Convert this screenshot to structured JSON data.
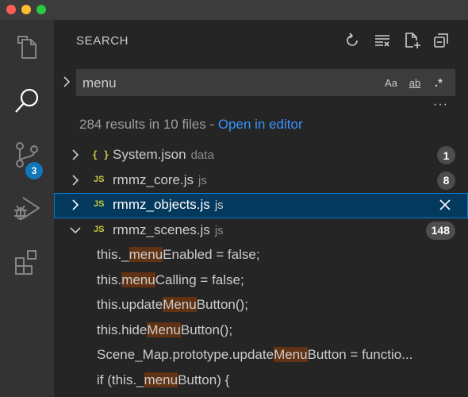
{
  "window": {
    "traffic_lights": [
      {
        "name": "close",
        "color": "#ff5f57"
      },
      {
        "name": "minimize",
        "color": "#febc2e"
      },
      {
        "name": "zoom",
        "color": "#28c840"
      }
    ]
  },
  "activity_bar": {
    "items": [
      {
        "name": "explorer",
        "icon": "files-icon",
        "active": false
      },
      {
        "name": "search",
        "icon": "search-icon",
        "active": true
      },
      {
        "name": "source-control",
        "icon": "source-control-icon",
        "active": false,
        "badge": "3"
      },
      {
        "name": "run-debug",
        "icon": "debug-icon",
        "active": false
      },
      {
        "name": "extensions",
        "icon": "extensions-icon",
        "active": false
      }
    ]
  },
  "sidebar": {
    "title": "SEARCH",
    "header_actions": [
      "refresh-icon",
      "clear-results-icon",
      "new-search-editor-icon",
      "collapse-all-icon"
    ]
  },
  "search": {
    "value": "menu",
    "options": {
      "match_case": "Aa",
      "match_whole_word": "ab",
      "use_regex": ".*"
    },
    "more_actions": "···"
  },
  "summary": {
    "text": "284 results in 10 files - ",
    "link": "Open in editor"
  },
  "results": {
    "files": [
      {
        "icon": "{ }",
        "icon_type": "json",
        "name": "System.json",
        "path": "data",
        "count": "1",
        "expanded": false,
        "selected": false
      },
      {
        "icon": "JS",
        "icon_type": "js",
        "name": "rmmz_core.js",
        "path": "js",
        "count": "8",
        "expanded": false,
        "selected": false
      },
      {
        "icon": "JS",
        "icon_type": "js",
        "name": "rmmz_objects.js",
        "path": "js",
        "count": "",
        "expanded": false,
        "selected": true
      },
      {
        "icon": "JS",
        "icon_type": "js",
        "name": "rmmz_scenes.js",
        "path": "js",
        "count": "148",
        "expanded": true,
        "selected": false
      }
    ],
    "matches": [
      {
        "before": "this._",
        "match": "menu",
        "after": "Enabled = false;"
      },
      {
        "before": "this.",
        "match": "menu",
        "after": "Calling = false;"
      },
      {
        "before": "this.update",
        "match": "Menu",
        "after": "Button();"
      },
      {
        "before": "this.hide",
        "match": "Menu",
        "after": "Button();"
      },
      {
        "before": "Scene_Map.prototype.update",
        "match": "Menu",
        "after": "Button = functio..."
      },
      {
        "before": "if (this._",
        "match": "menu",
        "after": "Button) {"
      }
    ]
  },
  "colors": {
    "activity_bar_bg": "#333333",
    "sidebar_bg": "#252526",
    "input_bg": "#3c3c3c",
    "accent_link": "#3794ff",
    "badge_bg": "#1177bb",
    "selection_bg": "#04395e",
    "selection_border": "#007fd4",
    "match_highlight": "#613214",
    "file_icon": "#cbcb41"
  }
}
